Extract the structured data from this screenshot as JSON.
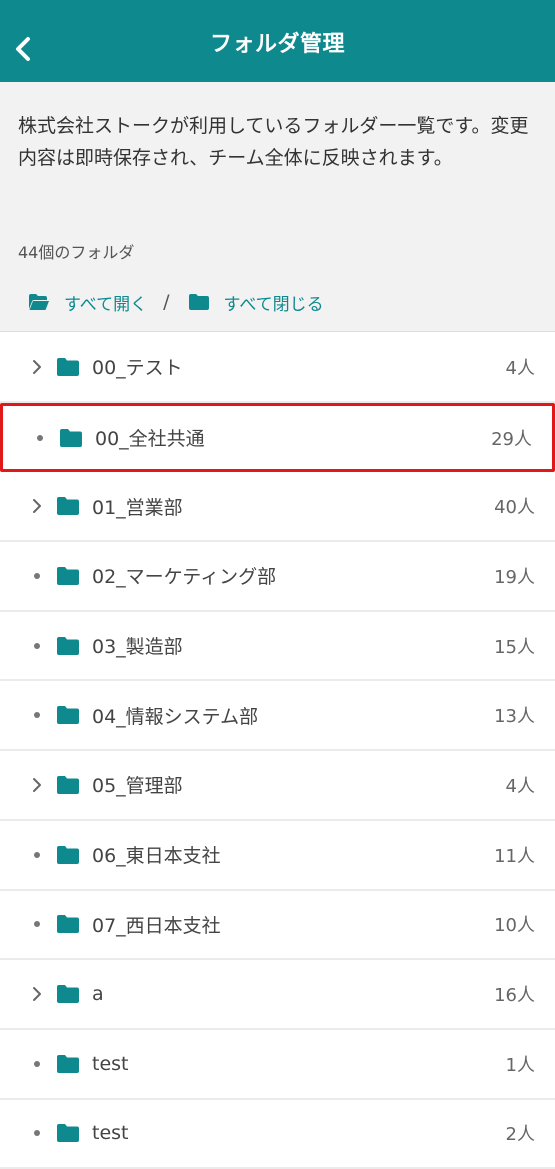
{
  "header": {
    "title": "フォルダ管理",
    "back_icon": "chevron-left-icon",
    "bg_color": "#0e8a8f"
  },
  "intro": {
    "description": "株式会社ストークが利用しているフォルダー一覧です。変更内容は即時保存され、チーム全体に反映されます。",
    "folder_count": "44個のフォルダ",
    "expand_all_label": "すべて開く",
    "separator": "/",
    "collapse_all_label": "すべて閉じる"
  },
  "accent_color": "#0e8a8f",
  "highlight_color": "#e01818",
  "folders": [
    {
      "name": "00_テスト",
      "count": "4人",
      "has_children": true
    },
    {
      "name": "00_全社共通",
      "count": "29人",
      "has_children": false,
      "highlighted": true
    },
    {
      "name": "01_営業部",
      "count": "40人",
      "has_children": true
    },
    {
      "name": "02_マーケティング部",
      "count": "19人",
      "has_children": false
    },
    {
      "name": "03_製造部",
      "count": "15人",
      "has_children": false
    },
    {
      "name": "04_情報システム部",
      "count": "13人",
      "has_children": false
    },
    {
      "name": "05_管理部",
      "count": "4人",
      "has_children": true
    },
    {
      "name": "06_東日本支社",
      "count": "11人",
      "has_children": false
    },
    {
      "name": "07_西日本支社",
      "count": "10人",
      "has_children": false
    },
    {
      "name": "a",
      "count": "16人",
      "has_children": true
    },
    {
      "name": "test",
      "count": "1人",
      "has_children": false
    },
    {
      "name": "test",
      "count": "2人",
      "has_children": false
    }
  ]
}
